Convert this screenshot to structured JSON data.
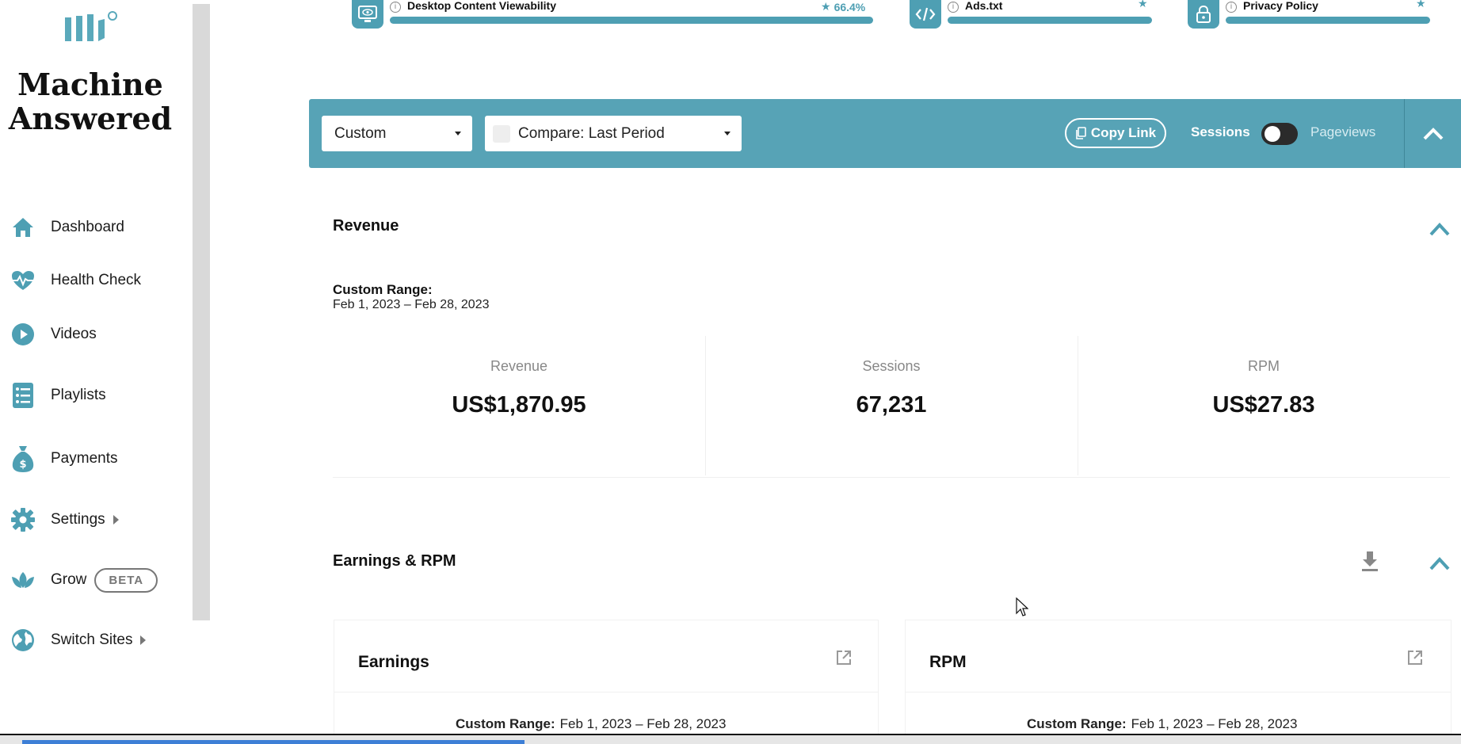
{
  "brand": {
    "name_line1": "Machine",
    "name_line2": "Answered"
  },
  "sidebar": {
    "items": [
      {
        "label": "Dashboard",
        "icon": "home-icon"
      },
      {
        "label": "Health Check",
        "icon": "heartbeat-icon"
      },
      {
        "label": "Videos",
        "icon": "play-icon"
      },
      {
        "label": "Playlists",
        "icon": "list-icon"
      },
      {
        "label": "Payments",
        "icon": "money-bag-icon"
      },
      {
        "label": "Settings",
        "icon": "gear-icon"
      },
      {
        "label": "Grow",
        "icon": "leaf-icon",
        "badge": "BETA"
      },
      {
        "label": "Switch Sites",
        "icon": "globe-icon"
      }
    ]
  },
  "health_cards": [
    {
      "name": "Desktop Content Viewability",
      "score": "66.4%",
      "icon": "monitor-eye-icon"
    },
    {
      "name": "Ads.txt",
      "icon": "code-icon"
    },
    {
      "name": "Privacy Policy",
      "icon": "lock-icon"
    }
  ],
  "filterbar": {
    "date_select": "Custom",
    "compare_select": "Compare: Last Period",
    "copy_link": "Copy Link",
    "toggle_left": "Sessions",
    "toggle_right": "Pageviews"
  },
  "revenue": {
    "title": "Revenue",
    "range_label": "Custom Range:",
    "range_value": "Feb 1, 2023 – Feb 28, 2023",
    "stats": [
      {
        "label": "Revenue",
        "value": "US$1,870.95"
      },
      {
        "label": "Sessions",
        "value": "67,231"
      },
      {
        "label": "RPM",
        "value": "US$27.83"
      }
    ]
  },
  "earnings_rpm": {
    "title": "Earnings & RPM",
    "cards": [
      {
        "title": "Earnings",
        "range_label": "Custom Range:",
        "range_value": "Feb 1, 2023 – Feb 28, 2023"
      },
      {
        "title": "RPM",
        "range_label": "Custom Range:",
        "range_value": "Feb 1, 2023 – Feb 28, 2023"
      }
    ]
  },
  "colors": {
    "accent": "#57a3b6",
    "icon": "#4e9fb3",
    "text": "#111111",
    "muted": "#888888"
  }
}
